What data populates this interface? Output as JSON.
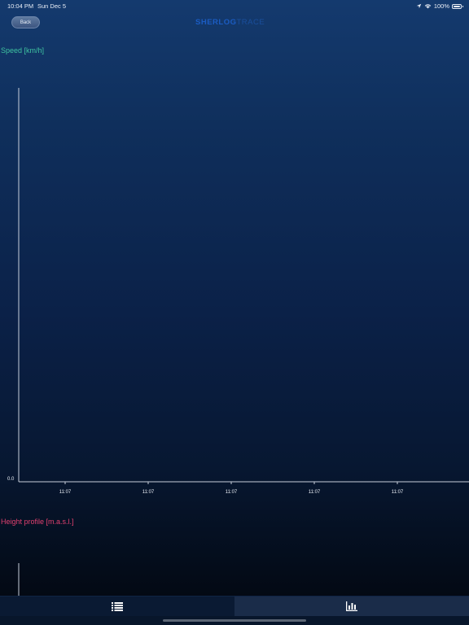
{
  "status_bar": {
    "time": "10:04 PM",
    "date": "Sun Dec 5",
    "battery": "100%"
  },
  "nav": {
    "back_label": "Back",
    "title_main": "SHERLOG",
    "title_suffix": "TRACE"
  },
  "charts": {
    "speed": {
      "label": "Speed [km/h]"
    },
    "height": {
      "label": "Height profile [m.a.s.l.]"
    }
  },
  "chart_data": [
    {
      "type": "line",
      "ylabel": "Speed [km/h]",
      "y_ticks": [
        "0.0"
      ],
      "x_ticks": [
        "11:07",
        "11:07",
        "11:07",
        "11:07",
        "11:07"
      ],
      "series": [],
      "grid": false
    },
    {
      "type": "line",
      "ylabel": "Height profile [m.a.s.l.]",
      "series": [],
      "grid": false
    }
  ],
  "tabs": [
    {
      "icon": "list-icon",
      "selected": false
    },
    {
      "icon": "bar-chart-icon",
      "selected": true
    }
  ],
  "colors": {
    "speed_label": "#3fc3a0",
    "height_label": "#e0406f",
    "title": "#1b5cc2"
  }
}
